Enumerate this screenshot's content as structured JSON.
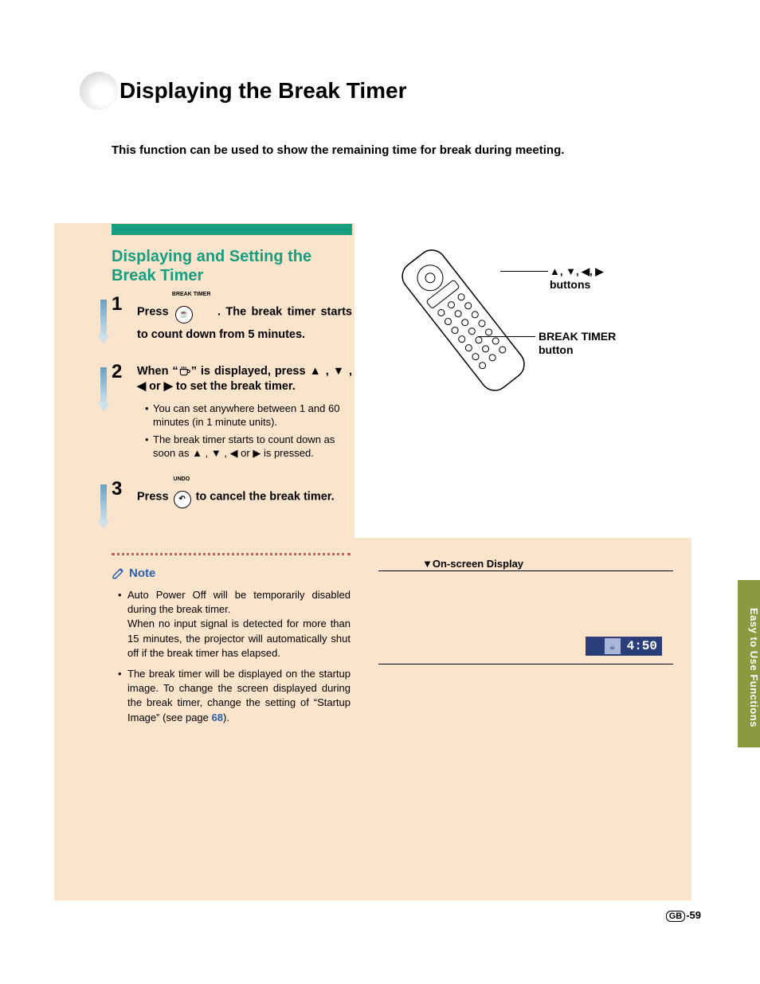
{
  "page": {
    "title": "Displaying the Break Timer",
    "intro": "This function can be used to show the remaining time for break during meeting.",
    "number": "-59",
    "region_code": "GB"
  },
  "section": {
    "heading": "Displaying and Setting the Break Timer"
  },
  "steps": [
    {
      "num": "1",
      "icon_label": "BREAK TIMER",
      "text_before": "Press ",
      "text_after": " . The break timer starts to count down from 5 minutes."
    },
    {
      "num": "2",
      "text_before": "When “",
      "text_mid": "” is displayed, press ",
      "arrows": "▲ , ▼ , ◀ or ▶",
      "text_after": " to set the break timer.",
      "bullets": [
        "You can set anywhere between 1 and 60 minutes (in 1 minute units).",
        "The break timer starts to count down as soon as ▲ , ▼ , ◀ or ▶ is pressed."
      ]
    },
    {
      "num": "3",
      "icon_label": "UNDO",
      "text_before": "Press ",
      "text_after": " to cancel the break timer."
    }
  ],
  "note": {
    "label": "Note",
    "items": [
      {
        "text": "Auto Power Off will be temporarily disabled during the break timer.\nWhen no input signal is detected for more than 15 minutes, the projector will automatically shut off if the break timer has elapsed."
      },
      {
        "text_before": "The break timer will be displayed on the startup image. To change the screen displayed during the break timer, change the setting of “Startup Image” (see page ",
        "page_ref": "68",
        "text_after": ")."
      }
    ]
  },
  "callouts": {
    "arrows_label_symbols": "▲, ▼, ◀, ▶",
    "arrows_label_text": "buttons",
    "break_timer_label1": "BREAK TIMER",
    "break_timer_label2": "button"
  },
  "osd": {
    "heading_marker": "▼",
    "heading": "On-screen Display",
    "value": "4:50"
  },
  "side_tab": "Easy to Use Functions"
}
